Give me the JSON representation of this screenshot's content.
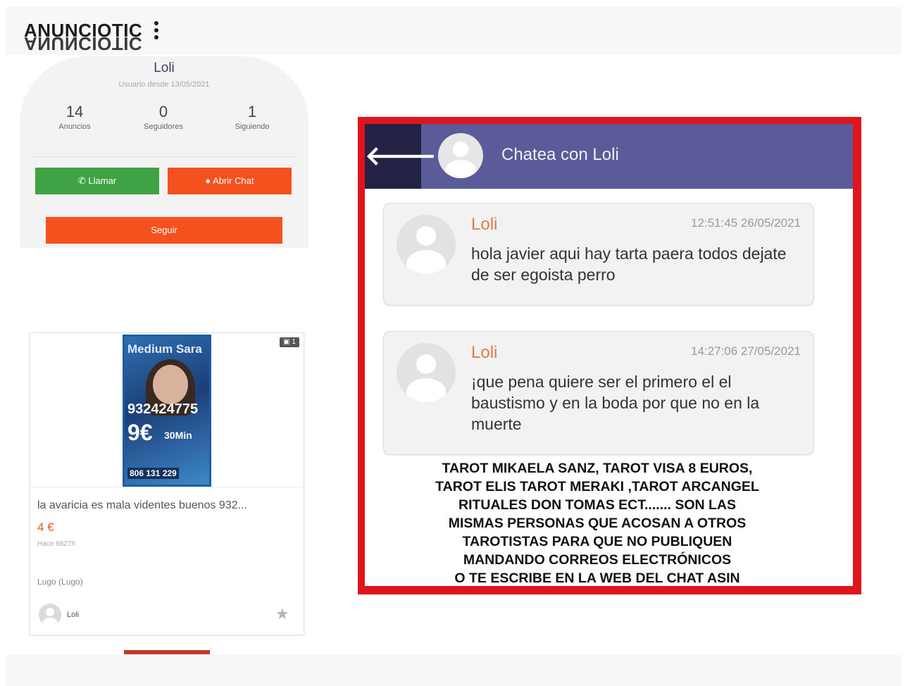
{
  "brand": {
    "logo_text": "ANUNCIOTIC"
  },
  "profile": {
    "name": "Loli",
    "member_since": "Usuario desde 13/05/2021",
    "stats": [
      {
        "value": "14",
        "label": "Anuncios"
      },
      {
        "value": "0",
        "label": "Seguidores"
      },
      {
        "value": "1",
        "label": "Siguiendo"
      }
    ],
    "call_label": "Llamar",
    "chat_label": "Abrir Chat",
    "follow_label": "Seguir",
    "colors": {
      "call": "#3fa346",
      "accent": "#f4511e"
    }
  },
  "listing": {
    "photo_count": "1",
    "image": {
      "brand": "Medium Sara",
      "phone": "932424775",
      "price": "9€",
      "duration": "30Min",
      "phone_bottom": "806 131 229"
    },
    "title": "la avaricia es mala videntes buenos 932...",
    "price": "4 €",
    "time_ago": "Hace 6827h",
    "location": "Lugo (Lugo)",
    "seller": "Loli"
  },
  "chat": {
    "title": "Chatea con Loli",
    "messages": [
      {
        "author": "Loli",
        "time": "12:51:45 26/05/2021",
        "text": "hola javier aqui hay tarta paera todos dejate de ser egoista perro"
      },
      {
        "author": "Loli",
        "time": "14:27:06 27/05/2021",
        "text": "¡que pena quiere ser el primero el el baustismo y en la boda por que no en la muerte"
      }
    ],
    "colors": {
      "header": "#5b5b99",
      "back": "#222244",
      "frame": "#e0141c",
      "author": "#e07b48"
    }
  },
  "overlay_text": [
    "TAROT MIKAELA SANZ, TAROT VISA 8 EUROS,",
    "TAROT ELIS TAROT MERAKI ,TAROT ARCANGEL",
    "RITUALES DON TOMAS ECT....... SON LAS",
    "MISMAS PERSONAS QUE ACOSAN A OTROS",
    "TAROTISTAS PARA QUE NO PUBLIQUEN",
    "MANDANDO CORREOS ELECTRÓNICOS",
    "O TE ESCRIBE EN LA WEB DEL CHAT ASIN"
  ]
}
